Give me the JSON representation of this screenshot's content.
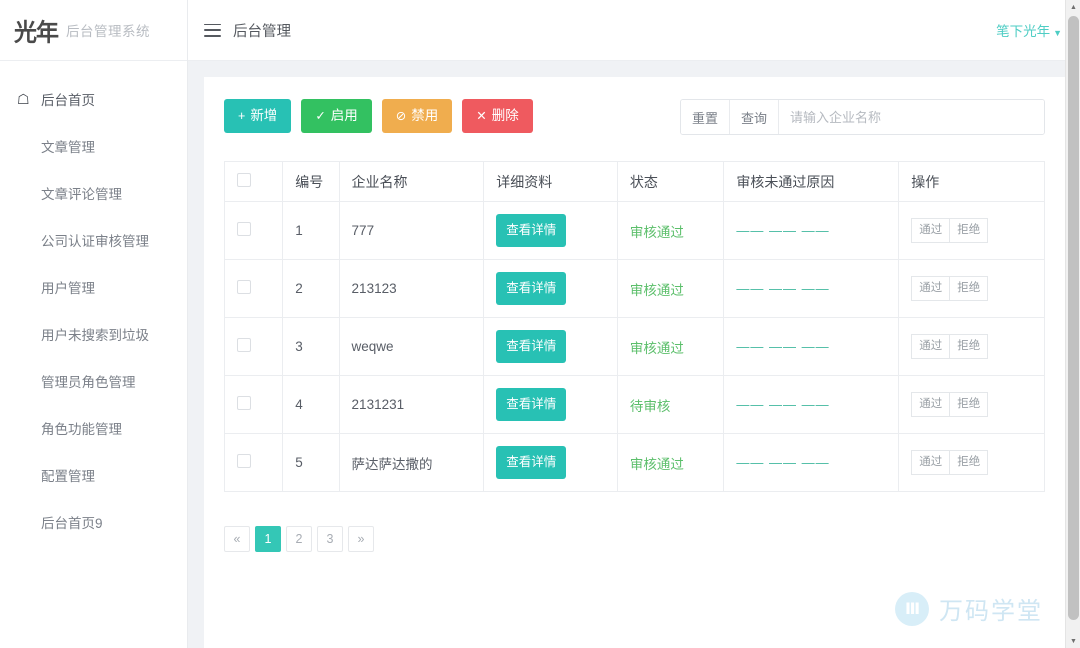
{
  "brand": {
    "logo_text": "光年",
    "logo_icon": "brand-logo-icon",
    "subtitle": "后台管理系统"
  },
  "sidebar": {
    "items": [
      {
        "label": "后台首页",
        "icon": "home-icon",
        "has_icon": true
      },
      {
        "label": "文章管理",
        "icon": "",
        "has_icon": false
      },
      {
        "label": "文章评论管理",
        "icon": "",
        "has_icon": false
      },
      {
        "label": "公司认证审核管理",
        "icon": "",
        "has_icon": false
      },
      {
        "label": "用户管理",
        "icon": "",
        "has_icon": false
      },
      {
        "label": "用户未搜索到垃圾",
        "icon": "",
        "has_icon": false
      },
      {
        "label": "管理员角色管理",
        "icon": "",
        "has_icon": false
      },
      {
        "label": "角色功能管理",
        "icon": "",
        "has_icon": false
      },
      {
        "label": "配置管理",
        "icon": "",
        "has_icon": false
      },
      {
        "label": "后台首页9",
        "icon": "",
        "has_icon": false
      }
    ]
  },
  "topbar": {
    "menu_icon": "hamburger-icon",
    "title": "后台管理",
    "user_name": "笔下光年",
    "user_caret": "▼"
  },
  "toolbar": {
    "buttons": [
      {
        "label": "新增",
        "glyph": "+",
        "color": "#28c1b4",
        "name": "add-button"
      },
      {
        "label": "启用",
        "glyph": "✓",
        "color": "#33c161",
        "name": "enable-button"
      },
      {
        "label": "禁用",
        "glyph": "⊘",
        "color": "#f0ad4e",
        "name": "disable-button"
      },
      {
        "label": "删除",
        "glyph": "✕",
        "color": "#ef5a5f",
        "name": "delete-button"
      }
    ]
  },
  "search": {
    "reset_label": "重置",
    "query_label": "查询",
    "placeholder": "请输入企业名称",
    "value": ""
  },
  "table": {
    "headers": [
      "",
      "编号",
      "企业名称",
      "详细资料",
      "状态",
      "审核未通过原因",
      "操作"
    ],
    "detail_label": "查看详情",
    "approve_label": "通过",
    "reject_label": "拒绝",
    "reason_placeholder": "—— —— ——",
    "rows": [
      {
        "no": "1",
        "name": "777",
        "status": "审核通过",
        "reason": "—— —— ——"
      },
      {
        "no": "2",
        "name": "213123",
        "status": "审核通过",
        "reason": "—— —— ——"
      },
      {
        "no": "3",
        "name": "weqwe",
        "status": "审核通过",
        "reason": "—— —— ——"
      },
      {
        "no": "4",
        "name": "2131231",
        "status": "待审核",
        "reason": "—— —— ——"
      },
      {
        "no": "5",
        "name": "萨达萨达撒的",
        "status": "审核通过",
        "reason": "—— —— ——"
      }
    ]
  },
  "pagination": {
    "prev": "«",
    "next": "»",
    "pages": [
      "1",
      "2",
      "3"
    ],
    "active": "1"
  },
  "watermark": {
    "mark": "Ⅲ",
    "text": "万码学堂"
  },
  "colors": {
    "teal": "#28c1b4",
    "green": "#33c161",
    "orange": "#f0ad4e",
    "red": "#ef5a5f",
    "status_green": "#5cbf6b",
    "page_bg": "#f0f2f5"
  }
}
